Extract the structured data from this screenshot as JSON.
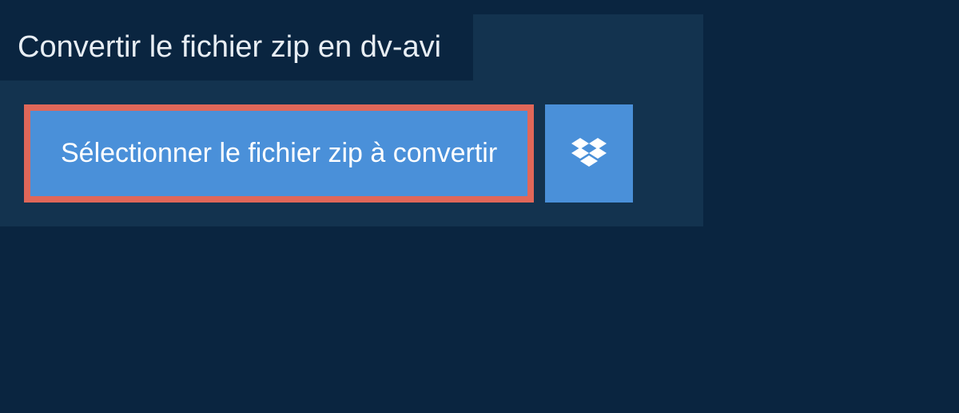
{
  "title": "Convertir le fichier zip en dv-avi",
  "select_button_label": "Sélectionner le fichier zip à convertir",
  "colors": {
    "page_bg": "#0a2540",
    "panel_bg": "#13334f",
    "button_bg": "#4a90d9",
    "highlight_border": "#e06759"
  }
}
